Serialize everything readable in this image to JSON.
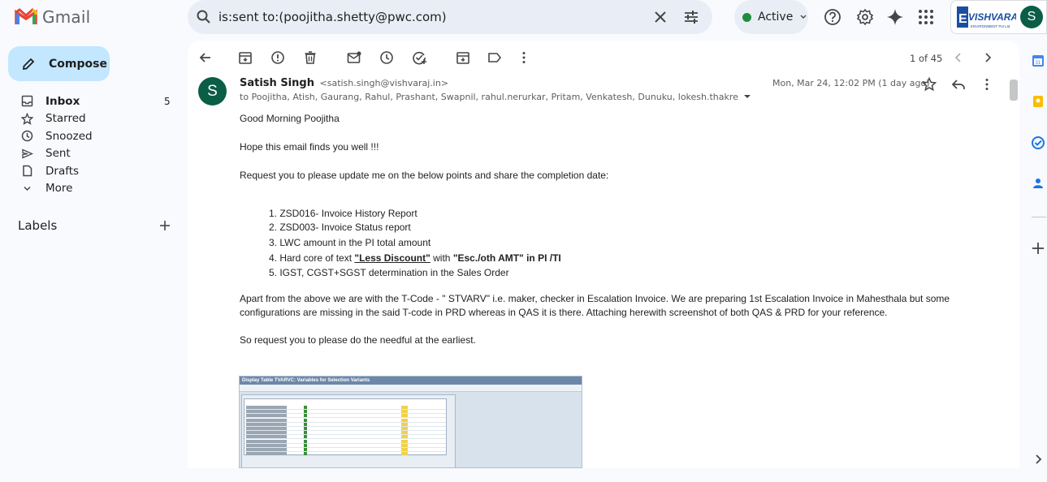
{
  "app": {
    "name": "Gmail"
  },
  "search": {
    "query": "is:sent to:(poojitha.shetty@pwc.com)"
  },
  "status": {
    "label": "Active",
    "color": "#1e8e3e"
  },
  "account": {
    "avatar_letter": "S",
    "brand": "VISHVARAJ",
    "brand_sub": "ENVIRONMENT Pvt Ltd"
  },
  "sidebar": {
    "compose_label": "Compose",
    "items": [
      {
        "label": "Inbox",
        "count": "5",
        "icon": "inbox-icon"
      },
      {
        "label": "Starred",
        "count": "",
        "icon": "star-icon"
      },
      {
        "label": "Snoozed",
        "count": "",
        "icon": "clock-icon"
      },
      {
        "label": "Sent",
        "count": "",
        "icon": "send-icon"
      },
      {
        "label": "Drafts",
        "count": "",
        "icon": "draft-icon"
      },
      {
        "label": "More",
        "count": "",
        "icon": "chevron-down-icon"
      }
    ],
    "labels_heading": "Labels"
  },
  "pager": {
    "text": "1 of 45"
  },
  "message": {
    "sender_initial": "S",
    "sender_name": "Satish Singh",
    "sender_email": "<satish.singh@vishvaraj.in>",
    "to_line": "to Poojitha, Atish, Gaurang, Rahul, Prashant, Swapnil, rahul.nerurkar, Pritam, Venkatesh, Dunuku, lokesh.thakre",
    "date": "Mon, Mar 24, 12:02 PM (1 day ago)",
    "greeting": "Good Morning Poojitha",
    "line2": "Hope this email finds you well !!!",
    "line3": "Request you to please update me on the below points and share the completion date:",
    "list": [
      "1. ZSD016- Invoice History Report",
      "2. ZSD003- Invoice Status report",
      "3. LWC amount in the PI total amount",
      "5. IGST, CGST+SGST determination in the Sales Order"
    ],
    "list4_prefix": "4. Hard core of text ",
    "list4_bold1": "\"Less Discount\"",
    "list4_mid": " with ",
    "list4_bold2": "\"Esc./oth AMT\"  in PI /TI",
    "para": "Apart from the above we are with the T-Code - \" STVARV\" i.e. maker, checker in Escalation Invoice. We are preparing 1st Escalation Invoice in Mahesthala but some configurations are missing in the said  T-code in PRD whereas in QAS it is there. Attaching herewith screenshot of both QAS & PRD for your reference.",
    "closing": "So request you to please do the needful at the earliest.",
    "screenshot_title": "Display Table TVARVC: Variables for Selection Variants"
  }
}
